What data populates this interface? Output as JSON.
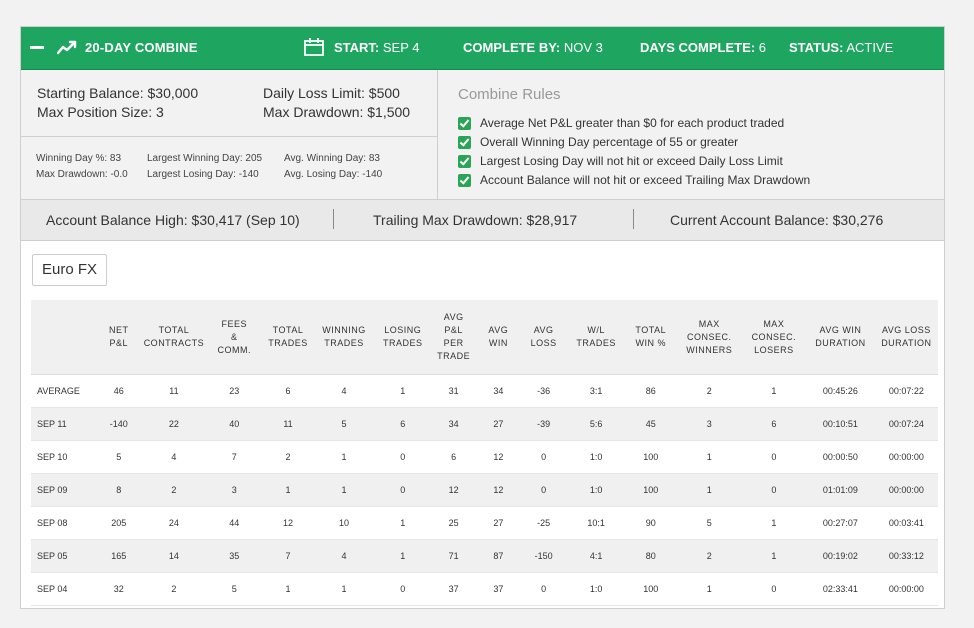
{
  "header": {
    "title": "20-DAY COMBINE",
    "start_label": "START:",
    "start_value": "SEP 4",
    "complete_label": "COMPLETE BY:",
    "complete_value": "NOV 3",
    "days_label": "DAYS COMPLETE:",
    "days_value": "6",
    "status_label": "STATUS:",
    "status_value": "ACTIVE",
    "icons": [
      "collapse-icon",
      "trend-icon",
      "calendar-icon"
    ],
    "color": "#1ea660"
  },
  "balances": {
    "starting_balance": "Starting Balance: $30,000",
    "max_position": "Max Position Size: 3",
    "daily_loss_limit": "Daily Loss Limit: $500",
    "max_drawdown": "Max Drawdown: $1,500"
  },
  "stats": {
    "winning_day_pct": "Winning Day %: 83",
    "max_drawdown": "Max Drawdown: -0.0",
    "largest_winning_day": "Largest Winning Day: 205",
    "largest_losing_day": "Largest Losing Day: -140",
    "avg_winning_day": "Avg. Winning Day: 83",
    "avg_losing_day": "Avg. Losing Day: -140"
  },
  "rules": {
    "title": "Combine Rules",
    "items": [
      "Average Net P&L greater than $0 for each product traded",
      "Overall Winning Day percentage of 55 or greater",
      "Largest Losing Day will not hit or exceed Daily Loss Limit",
      "Account Balance will not hit or exceed Trailing Max Drawdown"
    ]
  },
  "summary": {
    "balance_high": "Account Balance High: $30,417 (Sep 10)",
    "trailing_drawdown": "Trailing Max Drawdown: $28,917",
    "current_balance": "Current Account Balance: $30,276"
  },
  "product_button": "Euro FX",
  "table": {
    "columns": [
      [
        ""
      ],
      [
        "NET",
        "P&L"
      ],
      [
        "TOTAL",
        "CONTRACTS"
      ],
      [
        "FEES",
        "&",
        "COMM."
      ],
      [
        "TOTAL",
        "TRADES"
      ],
      [
        "WINNING",
        "TRADES"
      ],
      [
        "LOSING",
        "TRADES"
      ],
      [
        "AVG",
        "P&L",
        "PER",
        "TRADE"
      ],
      [
        "AVG",
        "WIN"
      ],
      [
        "AVG",
        "LOSS"
      ],
      [
        "W/L",
        "TRADES"
      ],
      [
        "TOTAL",
        "WIN %"
      ],
      [
        "MAX",
        "CONSEC.",
        "WINNERS"
      ],
      [
        "MAX",
        "CONSEC.",
        "LOSERS"
      ],
      [
        "AVG WIN",
        "DURATION"
      ],
      [
        "AVG LOSS",
        "DURATION"
      ]
    ],
    "rows": [
      [
        "AVERAGE",
        "46",
        "11",
        "23",
        "6",
        "4",
        "1",
        "31",
        "34",
        "-36",
        "3:1",
        "86",
        "2",
        "1",
        "00:45:26",
        "00:07:22"
      ],
      [
        "SEP 11",
        "-140",
        "22",
        "40",
        "11",
        "5",
        "6",
        "34",
        "27",
        "-39",
        "5:6",
        "45",
        "3",
        "6",
        "00:10:51",
        "00:07:24"
      ],
      [
        "SEP 10",
        "5",
        "4",
        "7",
        "2",
        "1",
        "0",
        "6",
        "12",
        "0",
        "1:0",
        "100",
        "1",
        "0",
        "00:00:50",
        "00:00:00"
      ],
      [
        "SEP 09",
        "8",
        "2",
        "3",
        "1",
        "1",
        "0",
        "12",
        "12",
        "0",
        "1:0",
        "100",
        "1",
        "0",
        "01:01:09",
        "00:00:00"
      ],
      [
        "SEP 08",
        "205",
        "24",
        "44",
        "12",
        "10",
        "1",
        "25",
        "27",
        "-25",
        "10:1",
        "90",
        "5",
        "1",
        "00:27:07",
        "00:03:41"
      ],
      [
        "SEP 05",
        "165",
        "14",
        "35",
        "7",
        "4",
        "1",
        "71",
        "87",
        "-150",
        "4:1",
        "80",
        "2",
        "1",
        "00:19:02",
        "00:33:12"
      ],
      [
        "SEP 04",
        "32",
        "2",
        "5",
        "1",
        "1",
        "0",
        "37",
        "37",
        "0",
        "1:0",
        "100",
        "1",
        "0",
        "02:33:41",
        "00:00:00"
      ]
    ]
  }
}
